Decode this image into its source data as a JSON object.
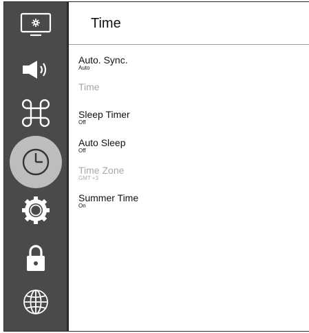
{
  "header": {
    "title": "Time"
  },
  "sidebar": {
    "items": [
      {
        "icon": "picture-settings-icon"
      },
      {
        "icon": "sound-icon"
      },
      {
        "icon": "command-icon"
      },
      {
        "icon": "clock-icon",
        "active": true
      },
      {
        "icon": "gear-icon"
      },
      {
        "icon": "lock-icon"
      },
      {
        "icon": "globe-icon"
      }
    ]
  },
  "menu": {
    "items": [
      {
        "label": "Auto. Sync.",
        "value": "Auto",
        "enabled": true
      },
      {
        "label": "Time",
        "value": "",
        "enabled": false
      },
      {
        "label": "Sleep Timer",
        "value": "Off",
        "enabled": true
      },
      {
        "label": "Auto Sleep",
        "value": "Off",
        "enabled": true
      },
      {
        "label": "Time Zone",
        "value": "GMT +3",
        "enabled": false
      },
      {
        "label": "Summer Time",
        "value": "On",
        "enabled": true
      }
    ]
  },
  "colors": {
    "sidebar_bg": "#4a4a4a",
    "active_highlight": "#bdbdbd",
    "disabled_text": "#a8a8a8"
  }
}
